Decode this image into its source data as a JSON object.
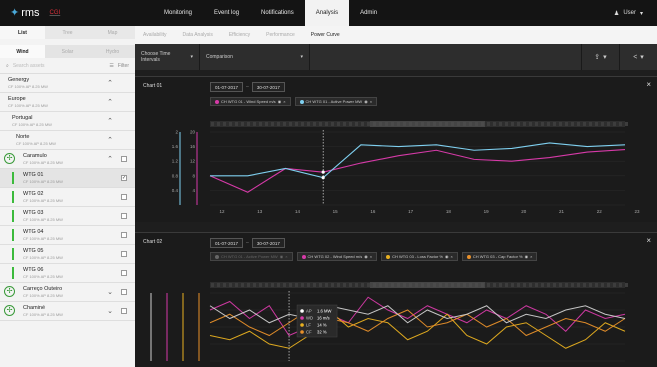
{
  "app": {
    "logo_text": "rms",
    "logo_sub": "CGI"
  },
  "topnav": [
    "Monitoring",
    "Event log",
    "Notifications",
    "Analysis",
    "Admin"
  ],
  "topnav_active": 3,
  "user": {
    "label": "User",
    "icon": "person-icon"
  },
  "left": {
    "tabs": [
      "List",
      "Tree",
      "Map"
    ],
    "subtabs": [
      "Wind",
      "Solar",
      "Hydro"
    ],
    "search_placeholder": "Search assets",
    "filter_label": "Filter",
    "items": [
      {
        "name": "Genergy",
        "meta": "CF 100%   AP 8.25 MW",
        "kind": "group"
      },
      {
        "name": "Europe",
        "meta": "CF 100%   AP 8.25 MW",
        "kind": "group"
      },
      {
        "name": "Portugal",
        "meta": "CF 100%   AP 8.25 MW",
        "kind": "group"
      },
      {
        "name": "Norte",
        "meta": "CF 100%   AP 8.25 MW",
        "kind": "group"
      },
      {
        "name": "Caramulo",
        "meta": "CF 100%   AP 8.25 MW",
        "kind": "park"
      },
      {
        "name": "WTG 01",
        "meta": "CF 100%   AP 8.25 MW",
        "kind": "wtg",
        "checked": true
      },
      {
        "name": "WTG 02",
        "meta": "CF 100%   AP 8.25 MW",
        "kind": "wtg"
      },
      {
        "name": "WTG 03",
        "meta": "CF 100%   AP 8.25 MW",
        "kind": "wtg"
      },
      {
        "name": "WTG 04",
        "meta": "CF 100%   AP 8.25 MW",
        "kind": "wtg"
      },
      {
        "name": "WTG 05",
        "meta": "CF 100%   AP 8.25 MW",
        "kind": "wtg"
      },
      {
        "name": "WTG 06",
        "meta": "CF 100%   AP 8.25 MW",
        "kind": "wtg"
      },
      {
        "name": "Carreço Outeiro",
        "meta": "CF 100%   AP 8.25 MW",
        "kind": "park"
      },
      {
        "name": "Chaminé",
        "meta": "CF 100%   AP 8.25 MW",
        "kind": "park"
      }
    ]
  },
  "subnav": [
    "Availability",
    "Data Analysis",
    "Efficiency",
    "Performance",
    "Power Curve"
  ],
  "subnav_active": 4,
  "toolbar": {
    "time_label": "Choose Time Intervals",
    "comparison_label": "Comparison"
  },
  "chart1": {
    "title": "Chart 01",
    "date_from": "01-07-2017",
    "date_to": "30-07-2017",
    "series_chips": [
      {
        "label": "CH WTG 01 - Wind Speed m/s",
        "color": "#d63aa8"
      },
      {
        "label": "CH WTG 01 - Active Power MW",
        "color": "#7fd0f0"
      }
    ]
  },
  "chart2": {
    "title": "Chart 02",
    "date_from": "01-07-2017",
    "date_to": "30-07-2017",
    "series_chips": [
      {
        "label": "CH WTG 01 - Active Power MW",
        "color": "#666666",
        "faded": true
      },
      {
        "label": "CH WTG 02 - Wind Speed m/s",
        "color": "#d63aa8"
      },
      {
        "label": "CH WTG 03 - Loss Factor %",
        "color": "#e8b020"
      },
      {
        "label": "CH WTG 03 - Cap Factor %",
        "color": "#e8902a"
      }
    ]
  },
  "chart_data": [
    {
      "type": "line",
      "title": "Chart 01",
      "x": [
        "12",
        "13",
        "14",
        "15",
        "16",
        "17",
        "18",
        "19",
        "20",
        "21",
        "22",
        "23"
      ],
      "y_ticks_left": [
        0.4,
        0.8,
        1.2,
        1.6,
        2
      ],
      "y_ticks_right": [
        4,
        8,
        12,
        16,
        20
      ],
      "series": [
        {
          "name": "CH WTG 01 - Wind Speed m/s",
          "color": "#d63aa8",
          "values": [
            0.8,
            0.35,
            1.0,
            0.9,
            1.15,
            1.35,
            1.5,
            1.25,
            1.2,
            1.3,
            1.45,
            1.52
          ]
        },
        {
          "name": "CH WTG 01 - Active Power MW",
          "color": "#7fd0f0",
          "values": [
            0.8,
            0.8,
            1.0,
            0.75,
            1.65,
            1.6,
            1.65,
            1.5,
            1.55,
            1.7,
            1.6,
            1.65
          ]
        }
      ],
      "cursor_index": 3
    },
    {
      "type": "line",
      "title": "Chart 02",
      "series": [
        {
          "name": "CH WTG 02 - Wind Speed m/s",
          "color": "#d63aa8",
          "values": [
            1.2,
            1.4,
            1.0,
            1.3,
            0.6,
            0.8,
            1.1,
            0.9,
            1.5,
            1.2,
            1.0,
            1.3,
            1.1,
            0.9,
            1.2,
            1.0,
            1.3,
            1.1,
            0.7,
            1.2,
            1.0,
            1.1
          ]
        },
        {
          "name": "CH WTG 03 - Loss Factor %",
          "color": "#e8b020",
          "values": [
            0.6,
            0.5,
            0.7,
            0.4,
            0.3,
            0.6,
            1.2,
            0.8,
            1.0,
            0.9,
            0.5,
            0.7,
            1.1,
            0.6,
            0.4,
            0.8,
            0.9,
            0.6,
            0.3,
            0.5,
            0.9,
            0.7
          ]
        },
        {
          "name": "CH WTG 03 - Cap Factor %",
          "color": "#e8902a",
          "values": [
            0.9,
            1.1,
            0.8,
            0.6,
            0.9,
            1.2,
            1.0,
            0.9,
            0.7,
            1.0,
            1.2,
            0.8,
            0.9,
            1.1,
            0.8,
            1.0,
            0.6,
            0.8,
            1.0,
            0.9,
            0.7,
            1.0
          ]
        },
        {
          "name": "CH WTG 01 - Active Power MW",
          "color": "#cfcfcf",
          "values": [
            1.3,
            1.0,
            1.2,
            0.9,
            1.1,
            1.0,
            1.3,
            1.2,
            1.1,
            1.3,
            0.9,
            1.2,
            1.0,
            1.1,
            1.3,
            0.9,
            1.1,
            1.0,
            1.2,
            1.3,
            1.1,
            1.0
          ]
        }
      ],
      "cursor_index": 4,
      "tooltip": [
        {
          "key": "AP",
          "value": "1.6 MW",
          "color": "#ffffff"
        },
        {
          "key": "WD",
          "value": "16 m/s",
          "color": "#d63aa8"
        },
        {
          "key": "LF",
          "value": "14 %",
          "color": "#e8b020"
        },
        {
          "key": "CF",
          "value": "32 %",
          "color": "#e8902a"
        }
      ]
    }
  ]
}
